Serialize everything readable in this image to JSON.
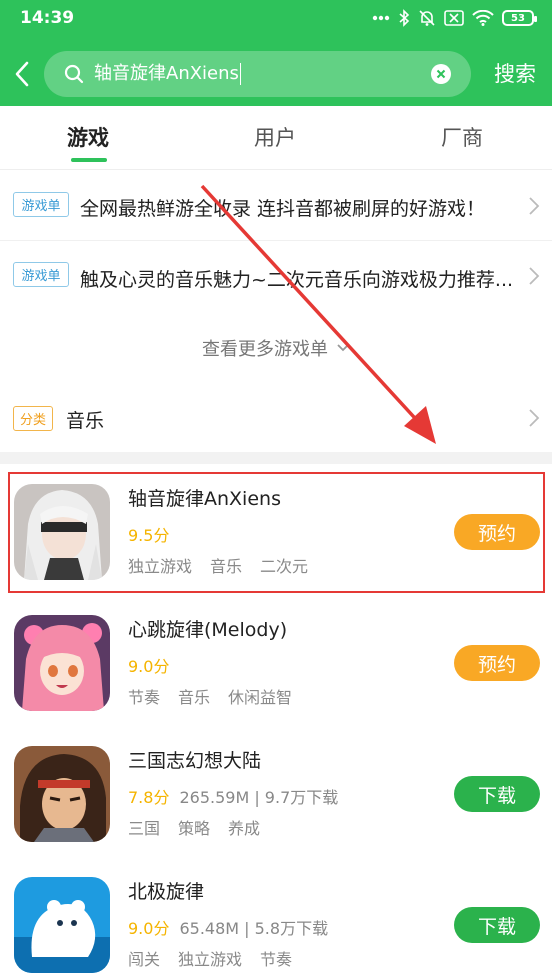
{
  "status_bar": {
    "time": "14:39",
    "battery": "53"
  },
  "search": {
    "query": "轴音旋律AnXiens",
    "action_label": "搜索"
  },
  "tabs": [
    {
      "label": "游戏",
      "active": true
    },
    {
      "label": "用户",
      "active": false
    },
    {
      "label": "厂商",
      "active": false
    }
  ],
  "game_lists": [
    {
      "tag": "游戏单",
      "title": "全网最热鲜游全收录 连抖音都被刷屏的好游戏！"
    },
    {
      "tag": "游戏单",
      "title": "触及心灵的音乐魅力~二次元音乐向游戏极力推荐..."
    }
  ],
  "more_game_lists": "查看更多游戏单",
  "category": {
    "tag": "分类",
    "label": "音乐"
  },
  "apps": [
    {
      "name": "轴音旋律AnXiens",
      "score": "9.5分",
      "size_downloads": "",
      "tags": [
        "独立游戏",
        "音乐",
        "二次元"
      ],
      "action": "预约",
      "action_type": "reserve"
    },
    {
      "name": "心跳旋律(Melody)",
      "score": "9.0分",
      "size_downloads": "",
      "tags": [
        "节奏",
        "音乐",
        "休闲益智"
      ],
      "action": "预约",
      "action_type": "reserve"
    },
    {
      "name": "三国志幻想大陆",
      "score": "7.8分",
      "size_downloads": "265.59M | 9.7万下载",
      "tags": [
        "三国",
        "策略",
        "养成"
      ],
      "action": "下载",
      "action_type": "download"
    },
    {
      "name": "北极旋律",
      "score": "9.0分",
      "size_downloads": "65.48M | 5.8万下载",
      "tags": [
        "闯关",
        "独立游戏",
        "节奏"
      ],
      "action": "下载",
      "action_type": "download"
    }
  ],
  "colors": {
    "brand_green": "#2ec25b",
    "reserve_orange": "#f9a825",
    "download_green": "#2bb24c",
    "score_yellow": "#f5b400",
    "annotation_red": "#e53935"
  }
}
